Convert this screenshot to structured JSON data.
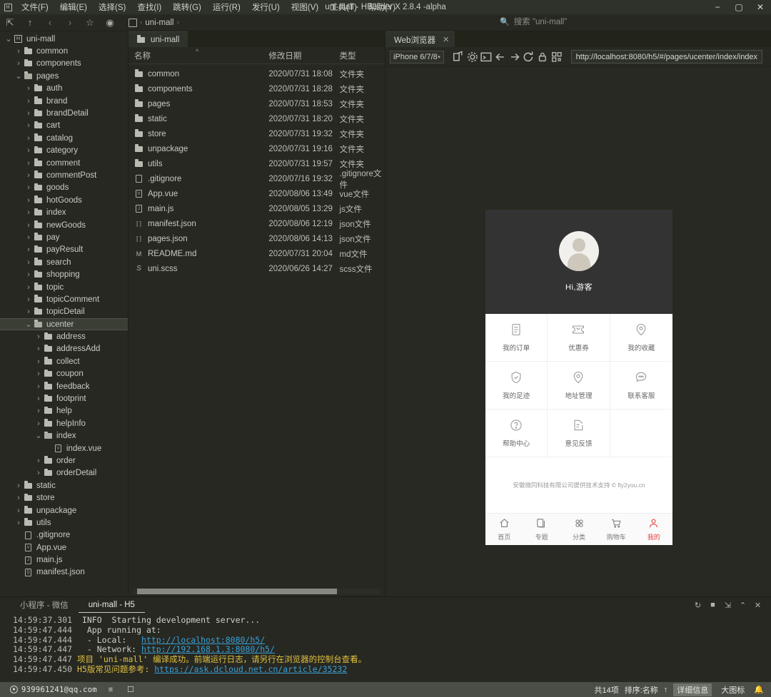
{
  "titlebar": {
    "logo": "hbuilder-logo-icon",
    "window_title": "uni-mall - HBuilder X 2.8.4 -alpha",
    "menus": [
      "文件(F)",
      "编辑(E)",
      "选择(S)",
      "查找(I)",
      "跳转(G)",
      "运行(R)",
      "发行(U)",
      "视图(V)",
      "工具(T)",
      "帮助(Y)"
    ],
    "minimize": "−",
    "maximize": "▢",
    "close": "✕"
  },
  "toolbar": {
    "icons": [
      "toggle-sidebar-icon",
      "up-icon",
      "back-icon",
      "forward-icon",
      "star-icon",
      "run-icon"
    ],
    "glyphs": [
      "⇱",
      "↑",
      "‹",
      "›",
      "☆",
      "◉"
    ],
    "breadcrumb_root": "uni-mall",
    "breadcrumb_sep": "›",
    "search_placeholder": "搜索 \"uni-mall\"",
    "search_icon": "search-file-icon"
  },
  "tree": {
    "items": [
      {
        "label": "uni-mall",
        "depth": 0,
        "type": "project",
        "arrow": "v",
        "selected": false
      },
      {
        "label": "common",
        "depth": 1,
        "type": "folder",
        "arrow": ">",
        "selected": false
      },
      {
        "label": "components",
        "depth": 1,
        "type": "folder",
        "arrow": ">",
        "selected": false
      },
      {
        "label": "pages",
        "depth": 1,
        "type": "folder-open",
        "arrow": "v",
        "selected": false
      },
      {
        "label": "auth",
        "depth": 2,
        "type": "folder",
        "arrow": ">",
        "selected": false
      },
      {
        "label": "brand",
        "depth": 2,
        "type": "folder",
        "arrow": ">",
        "selected": false
      },
      {
        "label": "brandDetail",
        "depth": 2,
        "type": "folder",
        "arrow": ">",
        "selected": false
      },
      {
        "label": "cart",
        "depth": 2,
        "type": "folder",
        "arrow": ">",
        "selected": false
      },
      {
        "label": "catalog",
        "depth": 2,
        "type": "folder",
        "arrow": ">",
        "selected": false
      },
      {
        "label": "category",
        "depth": 2,
        "type": "folder",
        "arrow": ">",
        "selected": false
      },
      {
        "label": "comment",
        "depth": 2,
        "type": "folder",
        "arrow": ">",
        "selected": false
      },
      {
        "label": "commentPost",
        "depth": 2,
        "type": "folder",
        "arrow": ">",
        "selected": false
      },
      {
        "label": "goods",
        "depth": 2,
        "type": "folder",
        "arrow": ">",
        "selected": false
      },
      {
        "label": "hotGoods",
        "depth": 2,
        "type": "folder",
        "arrow": ">",
        "selected": false
      },
      {
        "label": "index",
        "depth": 2,
        "type": "folder",
        "arrow": ">",
        "selected": false
      },
      {
        "label": "newGoods",
        "depth": 2,
        "type": "folder",
        "arrow": ">",
        "selected": false
      },
      {
        "label": "pay",
        "depth": 2,
        "type": "folder",
        "arrow": ">",
        "selected": false
      },
      {
        "label": "payResult",
        "depth": 2,
        "type": "folder",
        "arrow": ">",
        "selected": false
      },
      {
        "label": "search",
        "depth": 2,
        "type": "folder",
        "arrow": ">",
        "selected": false
      },
      {
        "label": "shopping",
        "depth": 2,
        "type": "folder",
        "arrow": ">",
        "selected": false
      },
      {
        "label": "topic",
        "depth": 2,
        "type": "folder",
        "arrow": ">",
        "selected": false
      },
      {
        "label": "topicComment",
        "depth": 2,
        "type": "folder",
        "arrow": ">",
        "selected": false
      },
      {
        "label": "topicDetail",
        "depth": 2,
        "type": "folder",
        "arrow": ">",
        "selected": false
      },
      {
        "label": "ucenter",
        "depth": 2,
        "type": "folder-open",
        "arrow": "v",
        "selected": true
      },
      {
        "label": "address",
        "depth": 3,
        "type": "folder",
        "arrow": ">",
        "selected": false
      },
      {
        "label": "addressAdd",
        "depth": 3,
        "type": "folder",
        "arrow": ">",
        "selected": false
      },
      {
        "label": "collect",
        "depth": 3,
        "type": "folder",
        "arrow": ">",
        "selected": false
      },
      {
        "label": "coupon",
        "depth": 3,
        "type": "folder",
        "arrow": ">",
        "selected": false
      },
      {
        "label": "feedback",
        "depth": 3,
        "type": "folder",
        "arrow": ">",
        "selected": false
      },
      {
        "label": "footprint",
        "depth": 3,
        "type": "folder",
        "arrow": ">",
        "selected": false
      },
      {
        "label": "help",
        "depth": 3,
        "type": "folder",
        "arrow": ">",
        "selected": false
      },
      {
        "label": "helpInfo",
        "depth": 3,
        "type": "folder",
        "arrow": ">",
        "selected": false
      },
      {
        "label": "index",
        "depth": 3,
        "type": "folder-open",
        "arrow": "v",
        "selected": false
      },
      {
        "label": "index.vue",
        "depth": 4,
        "type": "vue",
        "arrow": "",
        "selected": false
      },
      {
        "label": "order",
        "depth": 3,
        "type": "folder",
        "arrow": ">",
        "selected": false
      },
      {
        "label": "orderDetail",
        "depth": 3,
        "type": "folder",
        "arrow": ">",
        "selected": false
      },
      {
        "label": "static",
        "depth": 1,
        "type": "folder",
        "arrow": ">",
        "selected": false
      },
      {
        "label": "store",
        "depth": 1,
        "type": "folder",
        "arrow": ">",
        "selected": false
      },
      {
        "label": "unpackage",
        "depth": 1,
        "type": "folder",
        "arrow": ">",
        "selected": false
      },
      {
        "label": "utils",
        "depth": 1,
        "type": "folder",
        "arrow": ">",
        "selected": false
      },
      {
        "label": ".gitignore",
        "depth": 1,
        "type": "file",
        "arrow": "",
        "selected": false
      },
      {
        "label": "App.vue",
        "depth": 1,
        "type": "vue",
        "arrow": "",
        "selected": false
      },
      {
        "label": "main.js",
        "depth": 1,
        "type": "js",
        "arrow": "",
        "selected": false
      },
      {
        "label": "manifest.json",
        "depth": 1,
        "type": "json",
        "arrow": "",
        "selected": false
      }
    ]
  },
  "filepane": {
    "tab_label": "uni-mall",
    "tab_icon": "folder-icon",
    "columns": [
      "名称",
      "修改日期",
      "类型"
    ],
    "sort_arrow": "^",
    "rows": [
      {
        "icon": "folder-icon",
        "name": "common",
        "date": "2020/07/31 18:08",
        "type": "文件夹"
      },
      {
        "icon": "folder-icon",
        "name": "components",
        "date": "2020/07/31 18:28",
        "type": "文件夹"
      },
      {
        "icon": "folder-icon",
        "name": "pages",
        "date": "2020/07/31 18:53",
        "type": "文件夹"
      },
      {
        "icon": "folder-icon",
        "name": "static",
        "date": "2020/07/31 18:20",
        "type": "文件夹"
      },
      {
        "icon": "folder-icon",
        "name": "store",
        "date": "2020/07/31 19:32",
        "type": "文件夹"
      },
      {
        "icon": "folder-icon",
        "name": "unpackage",
        "date": "2020/07/31 19:16",
        "type": "文件夹"
      },
      {
        "icon": "folder-icon",
        "name": "utils",
        "date": "2020/07/31 19:57",
        "type": "文件夹"
      },
      {
        "icon": "file-icon",
        "name": ".gitignore",
        "date": "2020/07/16 19:32",
        "type": ".gitignore文件"
      },
      {
        "icon": "vue-file-icon",
        "name": "App.vue",
        "date": "2020/08/06 13:49",
        "type": "vue文件"
      },
      {
        "icon": "js-file-icon",
        "name": "main.js",
        "date": "2020/08/05 13:29",
        "type": "js文件"
      },
      {
        "icon": "json-file-icon",
        "name": "manifest.json",
        "date": "2020/08/06 12:19",
        "type": "json文件"
      },
      {
        "icon": "json-file-icon",
        "name": "pages.json",
        "date": "2020/08/06 14:13",
        "type": "json文件"
      },
      {
        "icon": "md-file-icon",
        "name": "README.md",
        "date": "2020/07/31 20:04",
        "type": "md文件"
      },
      {
        "icon": "scss-file-icon",
        "name": "uni.scss",
        "date": "2020/06/26 14:27",
        "type": "scss文件"
      }
    ]
  },
  "webpane": {
    "tab_label": "Web浏览器",
    "tab_close": "✕",
    "device": "iPhone 6/7/8",
    "device_caret": "▾",
    "icons": [
      "open-external-icon",
      "settings-gear-icon",
      "console-icon",
      "back-arrow-icon",
      "forward-arrow-icon",
      "reload-icon",
      "lock-icon",
      "qrcode-icon"
    ],
    "url": "http://localhost:8080/h5/#/pages/ucenter/index/index"
  },
  "phone": {
    "greeting": "Hi,游客",
    "avatar": "user-avatar-icon",
    "grid": [
      {
        "icon": "order-list-icon",
        "label": "我的订单"
      },
      {
        "icon": "coupon-ticket-icon",
        "label": "优惠券"
      },
      {
        "icon": "location-pin-icon",
        "label": "我的收藏"
      },
      {
        "icon": "shield-check-icon",
        "label": "我的足迹"
      },
      {
        "icon": "location-pin-icon",
        "label": "地址管理"
      },
      {
        "icon": "chat-bubble-icon",
        "label": "联系客服"
      },
      {
        "icon": "question-circle-icon",
        "label": "帮助中心"
      },
      {
        "icon": "edit-note-icon",
        "label": "意见反馈"
      },
      {
        "icon": "",
        "label": ""
      }
    ],
    "copyright": "安徽微同科技有限公司提供技术支持 © fly2you.cn",
    "tabs": [
      {
        "icon": "home-icon",
        "label": "首页",
        "active": false
      },
      {
        "icon": "topic-icon",
        "label": "专题",
        "active": false
      },
      {
        "icon": "category-icon",
        "label": "分类",
        "active": false
      },
      {
        "icon": "cart-icon",
        "label": "购物车",
        "active": false
      },
      {
        "icon": "user-icon",
        "label": "我的",
        "active": true
      }
    ],
    "accent": "#e93b3d"
  },
  "console": {
    "tabs": [
      {
        "label": "小程序 - 微信",
        "active": false
      },
      {
        "label": "uni-mall - H5",
        "active": true
      }
    ],
    "ctrl_icons": [
      "rerun-icon",
      "stop-icon",
      "export-icon",
      "collapse-icon",
      "clear-icon"
    ],
    "ctrl_glyphs": [
      "↻",
      "■",
      "⇲",
      "⌃",
      "✕"
    ],
    "lines": [
      {
        "ts": "14:59:37.301",
        "parts": [
          {
            "t": "  INFO  Starting development server...",
            "c": "lvl"
          }
        ]
      },
      {
        "ts": "14:59:47.444",
        "parts": [
          {
            "t": "   App running at:",
            "c": "lvl"
          }
        ]
      },
      {
        "ts": "14:59:47.444",
        "parts": [
          {
            "t": "   - Local:   ",
            "c": "lvl"
          },
          {
            "t": "http://localhost:8080/h5/",
            "c": "link"
          }
        ]
      },
      {
        "ts": "14:59:47.447",
        "parts": [
          {
            "t": "   - Network: ",
            "c": "lvl"
          },
          {
            "t": "http://192.168.1.3:8080/h5/",
            "c": "link"
          }
        ]
      },
      {
        "ts": "14:59:47.447",
        "parts": [
          {
            "t": " 项目 'uni-mall' 编译成功。前端运行日志，请另行在浏览器的控制台查看。",
            "c": "warn"
          }
        ]
      },
      {
        "ts": "14:59:47.450",
        "parts": [
          {
            "t": " H5版常见问题参考: ",
            "c": "warn"
          },
          {
            "t": "https://ask.dcloud.net.cn/article/35232",
            "c": "link"
          }
        ]
      }
    ]
  },
  "statusbar": {
    "account": "939961241@qq.com",
    "account_icon": "user-circle-icon",
    "left_icons": [
      "outline-icon",
      "terminal-icon"
    ],
    "count": "共14项",
    "sort": "排序:名称",
    "sort_arrow": "↑",
    "view_detail": "详细信息",
    "view_large": "大图标",
    "bell": "notification-bell-icon"
  }
}
